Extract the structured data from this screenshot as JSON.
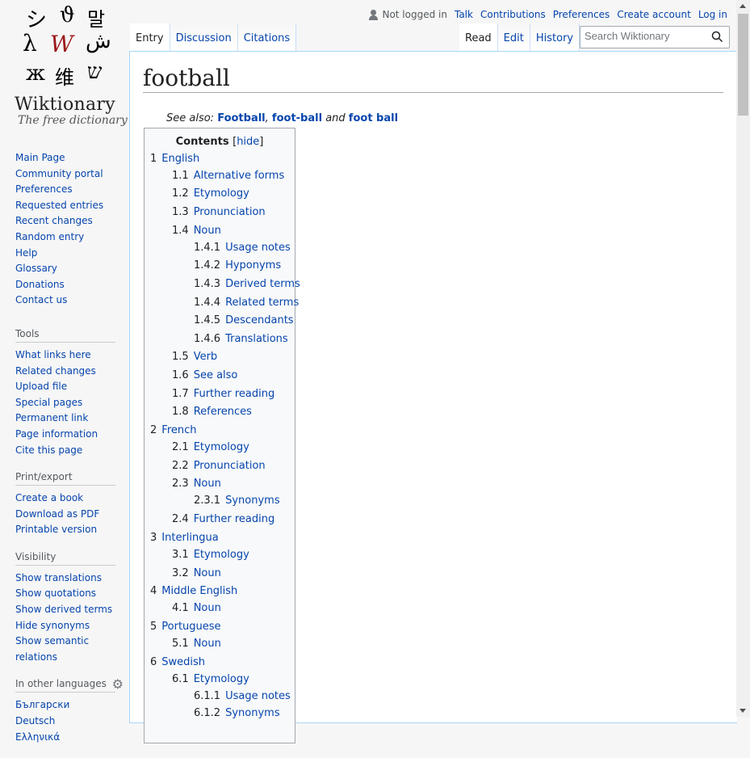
{
  "logo": {
    "glyphs": [
      "シ",
      "ϑ",
      "말",
      "λ",
      "W",
      "ش",
      "ж",
      "维",
      "ש"
    ],
    "wordmark": "Wiktionary",
    "tagline": "The free dictionary"
  },
  "sidebar": {
    "nav": [
      "Main Page",
      "Community portal",
      "Preferences",
      "Requested entries",
      "Recent changes",
      "Random entry",
      "Help",
      "Glossary",
      "Donations",
      "Contact us"
    ],
    "tools": {
      "heading": "Tools",
      "items": [
        "What links here",
        "Related changes",
        "Upload file",
        "Special pages",
        "Permanent link",
        "Page information",
        "Cite this page"
      ]
    },
    "print": {
      "heading": "Print/export",
      "items": [
        "Create a book",
        "Download as PDF",
        "Printable version"
      ]
    },
    "visibility": {
      "heading": "Visibility",
      "items": [
        "Show translations",
        "Show quotations",
        "Show derived terms",
        "Hide synonyms",
        "Show semantic relations"
      ]
    },
    "languages": {
      "heading": "In other languages",
      "items": [
        "Български",
        "Deutsch",
        "Ελληνικά"
      ]
    }
  },
  "personal": {
    "not_logged_in": "Not logged in",
    "links": [
      "Talk",
      "Contributions",
      "Preferences",
      "Create account",
      "Log in"
    ]
  },
  "tabs": {
    "left": [
      "Entry",
      "Discussion",
      "Citations"
    ],
    "right": [
      "Read",
      "Edit",
      "History"
    ]
  },
  "search": {
    "placeholder": "Search Wiktionary"
  },
  "page": {
    "title": "football",
    "seealso": {
      "prefix": "See also:",
      "links": [
        "Football",
        "foot-ball",
        "foot ball"
      ],
      "sep": ",",
      "and": "and"
    }
  },
  "toc": {
    "title": "Contents",
    "hide": "hide",
    "items": [
      {
        "num": "1",
        "text": "English",
        "level": 1
      },
      {
        "num": "1.1",
        "text": "Alternative forms",
        "level": 2
      },
      {
        "num": "1.2",
        "text": "Etymology",
        "level": 2
      },
      {
        "num": "1.3",
        "text": "Pronunciation",
        "level": 2
      },
      {
        "num": "1.4",
        "text": "Noun",
        "level": 2
      },
      {
        "num": "1.4.1",
        "text": "Usage notes",
        "level": 3
      },
      {
        "num": "1.4.2",
        "text": "Hyponyms",
        "level": 3
      },
      {
        "num": "1.4.3",
        "text": "Derived terms",
        "level": 3
      },
      {
        "num": "1.4.4",
        "text": "Related terms",
        "level": 3
      },
      {
        "num": "1.4.5",
        "text": "Descendants",
        "level": 3
      },
      {
        "num": "1.4.6",
        "text": "Translations",
        "level": 3
      },
      {
        "num": "1.5",
        "text": "Verb",
        "level": 2
      },
      {
        "num": "1.6",
        "text": "See also",
        "level": 2
      },
      {
        "num": "1.7",
        "text": "Further reading",
        "level": 2
      },
      {
        "num": "1.8",
        "text": "References",
        "level": 2
      },
      {
        "num": "2",
        "text": "French",
        "level": 1
      },
      {
        "num": "2.1",
        "text": "Etymology",
        "level": 2
      },
      {
        "num": "2.2",
        "text": "Pronunciation",
        "level": 2
      },
      {
        "num": "2.3",
        "text": "Noun",
        "level": 2
      },
      {
        "num": "2.3.1",
        "text": "Synonyms",
        "level": 3
      },
      {
        "num": "2.4",
        "text": "Further reading",
        "level": 2
      },
      {
        "num": "3",
        "text": "Interlingua",
        "level": 1
      },
      {
        "num": "3.1",
        "text": "Etymology",
        "level": 2
      },
      {
        "num": "3.2",
        "text": "Noun",
        "level": 2
      },
      {
        "num": "4",
        "text": "Middle English",
        "level": 1
      },
      {
        "num": "4.1",
        "text": "Noun",
        "level": 2
      },
      {
        "num": "5",
        "text": "Portuguese",
        "level": 1
      },
      {
        "num": "5.1",
        "text": "Noun",
        "level": 2
      },
      {
        "num": "6",
        "text": "Swedish",
        "level": 1
      },
      {
        "num": "6.1",
        "text": "Etymology",
        "level": 2
      },
      {
        "num": "6.1.1",
        "text": "Usage notes",
        "level": 3
      },
      {
        "num": "6.1.2",
        "text": "Synonyms",
        "level": 3
      }
    ]
  },
  "colors": {
    "link": "#0645ad",
    "text": "#202122",
    "border": "#a7d7f9",
    "background": "#f6f6f6"
  }
}
